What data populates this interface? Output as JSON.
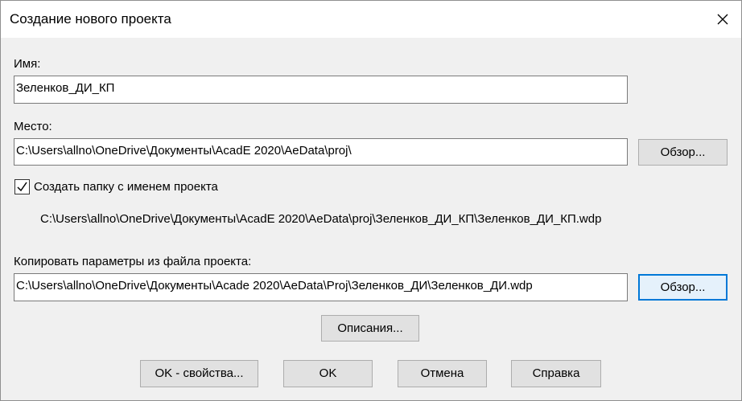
{
  "dialog": {
    "title": "Создание нового проекта"
  },
  "name_field": {
    "label": "Имя:",
    "value": "Зеленков_ДИ_КП"
  },
  "location_field": {
    "label": "Место:",
    "value": "C:\\Users\\allno\\OneDrive\\Документы\\AcadE 2020\\AeData\\proj\\",
    "browse_label": "Обзор..."
  },
  "create_folder": {
    "label": "Создать папку с именем проекта",
    "checked": true,
    "resulting_path": "C:\\Users\\allno\\OneDrive\\Документы\\AcadE 2020\\AeData\\proj\\Зеленков_ДИ_КП\\Зеленков_ДИ_КП.wdp"
  },
  "copy_settings": {
    "label": "Копировать параметры из файла проекта:",
    "value": "C:\\Users\\allno\\OneDrive\\Документы\\Acade 2020\\AeData\\Proj\\Зеленков_ДИ\\Зеленков_ДИ.wdp",
    "browse_label": "Обзор..."
  },
  "buttons": {
    "descriptions": "Описания...",
    "ok_properties": "OK - свойства...",
    "ok": "OK",
    "cancel": "Отмена",
    "help": "Справка"
  },
  "icons": {
    "close": "close-icon",
    "check": "checkmark-icon"
  },
  "colors": {
    "dialog_bg": "#f0f0f0",
    "titlebar_bg": "#ffffff",
    "focus_border": "#0078d7",
    "button_bg": "#e1e1e1"
  }
}
